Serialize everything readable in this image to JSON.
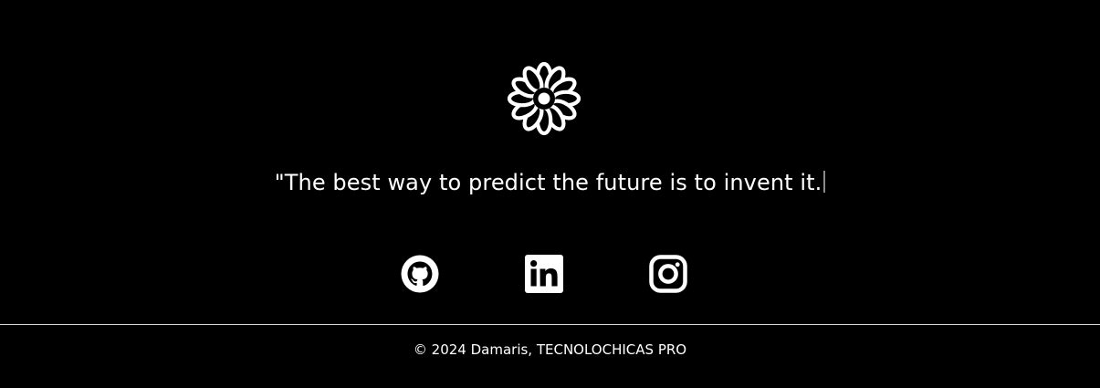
{
  "logo": {
    "icon": "flower-icon"
  },
  "quote": {
    "text": "\"The best way to predict the future is to invent it."
  },
  "social": {
    "links": [
      {
        "label": "GitHub",
        "icon": "github-icon"
      },
      {
        "label": "LinkedIn",
        "icon": "linkedin-icon"
      },
      {
        "label": "Instagram",
        "icon": "instagram-icon"
      }
    ]
  },
  "footer": {
    "copyright": "© 2024 Damaris, TECNOLOCHICAS PRO"
  },
  "colors": {
    "background": "#000000",
    "foreground": "#ffffff",
    "divider": "#dcdcdc"
  }
}
